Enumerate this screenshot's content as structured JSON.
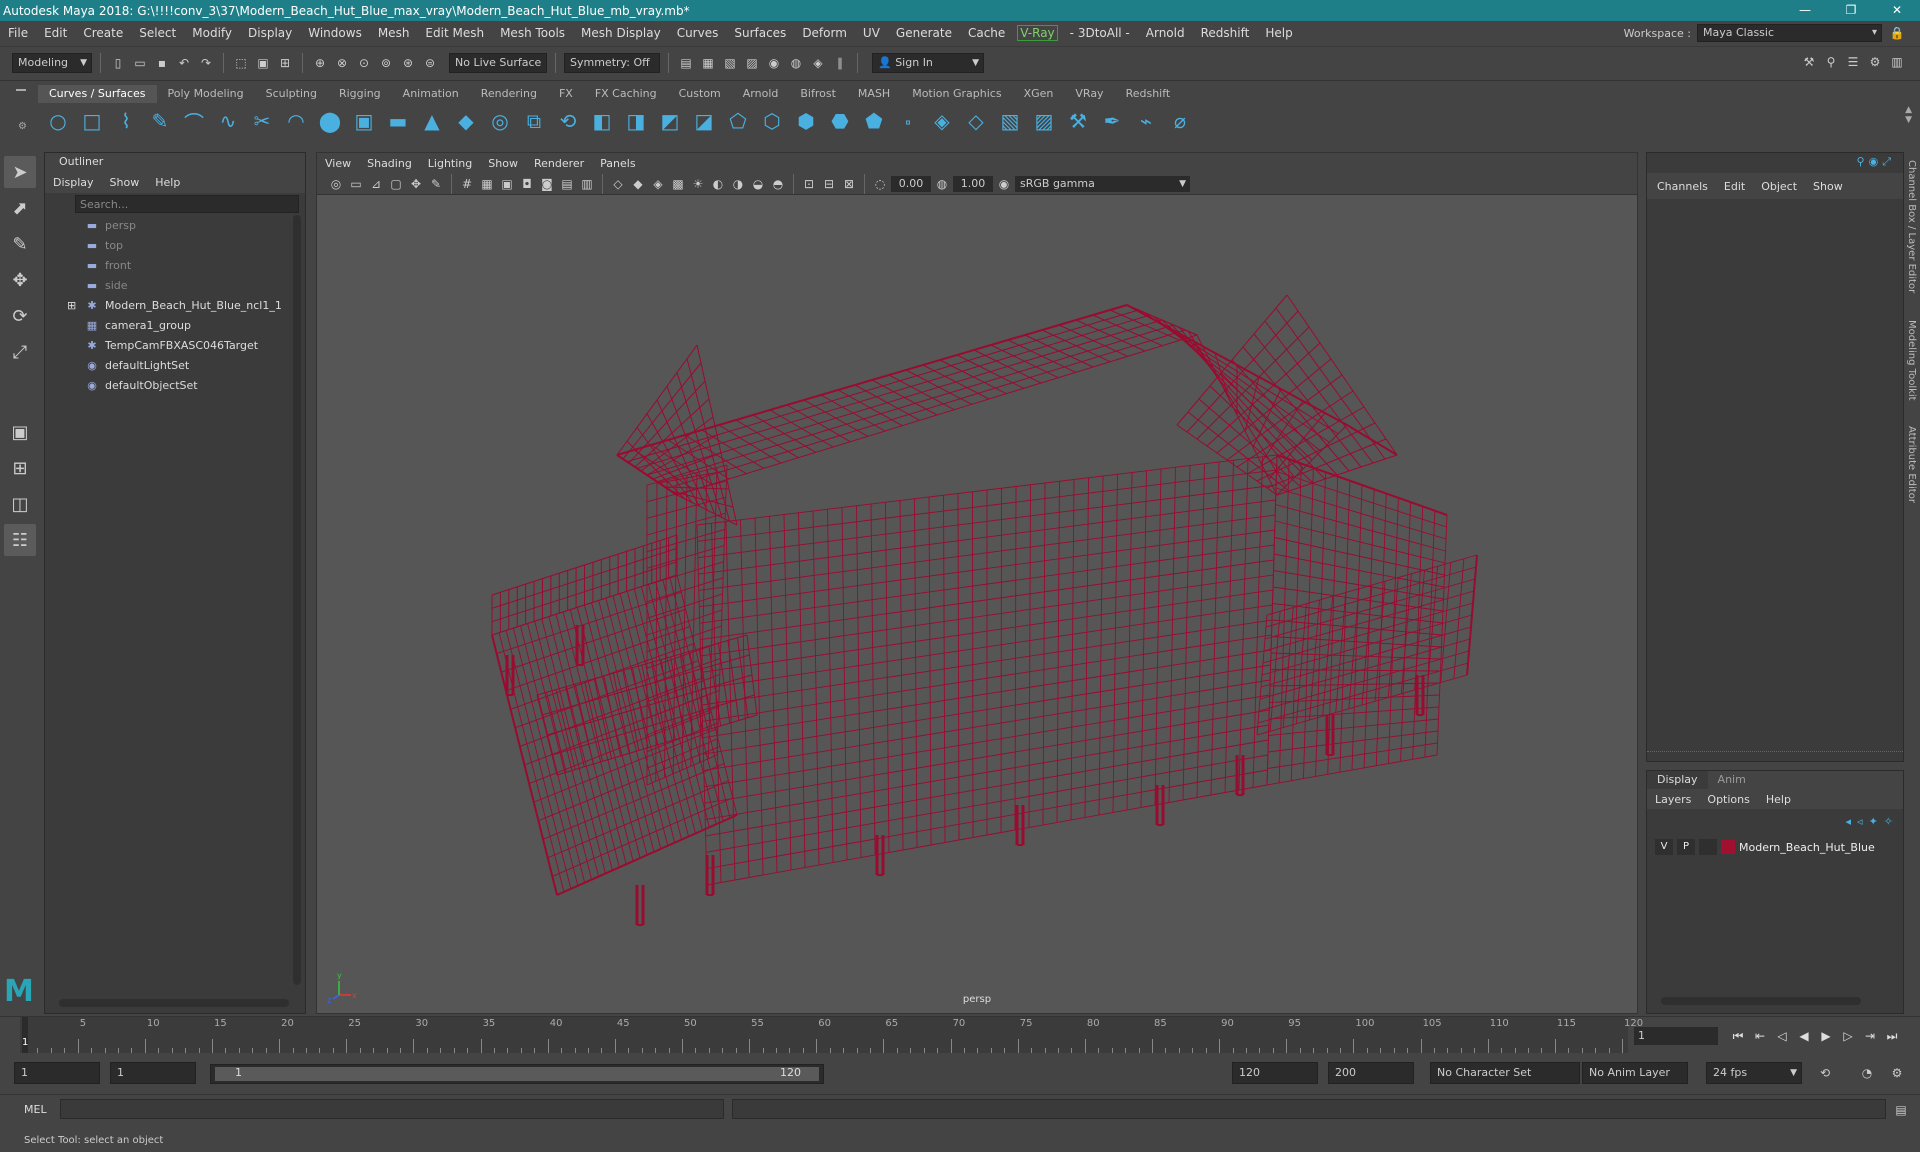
{
  "window": {
    "title": "Autodesk Maya 2018: G:\\!!!!conv_3\\37\\Modern_Beach_Hut_Blue_max_vray\\Modern_Beach_Hut_Blue_mb_vray.mb*",
    "controls": [
      "—",
      "❐",
      "✕"
    ]
  },
  "menus": [
    "File",
    "Edit",
    "Create",
    "Select",
    "Modify",
    "Display",
    "Windows",
    "Mesh",
    "Edit Mesh",
    "Mesh Tools",
    "Mesh Display",
    "Curves",
    "Surfaces",
    "Deform",
    "UV",
    "Generate",
    "Cache"
  ],
  "menus_after": [
    "- 3DtoAll -",
    "Arnold",
    "Redshift",
    "Help"
  ],
  "vray_menu": "V-Ray",
  "workspace": {
    "label": "Workspace :",
    "value": "Maya Classic"
  },
  "status_line": {
    "mode": "Modeling",
    "live_surface": "No Live Surface",
    "symmetry": "Symmetry: Off",
    "sign_in": "Sign In"
  },
  "shelf": {
    "tabs": [
      "Curves / Surfaces",
      "Poly Modeling",
      "Sculpting",
      "Rigging",
      "Animation",
      "Rendering",
      "FX",
      "FX Caching",
      "Custom",
      "Arnold",
      "Bifrost",
      "MASH",
      "Motion Graphics",
      "XGen",
      "VRay",
      "Redshift"
    ],
    "active": "Curves / Surfaces",
    "icons": [
      "nurbs-circle-icon",
      "nurbs-square-icon",
      "cv-curve-icon",
      "ep-curve-icon",
      "pencil-curve-icon",
      "bezier-curve-icon",
      "curve-tool-icon",
      "arc-icon",
      "sphere-icon",
      "cube-icon",
      "cylinder-icon",
      "cone-icon",
      "plane-icon",
      "torus-icon",
      "loft-icon",
      "revolve-icon"
    ]
  },
  "outliner": {
    "title": "Outliner",
    "menu": [
      "Display",
      "Show",
      "Help"
    ],
    "search_placeholder": "Search...",
    "items": [
      {
        "label": "persp",
        "icon": "camera-icon",
        "dim": true
      },
      {
        "label": "top",
        "icon": "camera-icon",
        "dim": true
      },
      {
        "label": "front",
        "icon": "camera-icon",
        "dim": true
      },
      {
        "label": "side",
        "icon": "camera-icon",
        "dim": true
      },
      {
        "label": "Modern_Beach_Hut_Blue_ncl1_1",
        "icon": "transform-icon",
        "dim": false,
        "expand": true
      },
      {
        "label": "camera1_group",
        "icon": "group-icon",
        "dim": false
      },
      {
        "label": "TempCamFBXASC046Target",
        "icon": "transform-icon",
        "dim": false
      },
      {
        "label": "defaultLightSet",
        "icon": "set-icon",
        "dim": false
      },
      {
        "label": "defaultObjectSet",
        "icon": "set-icon",
        "dim": false
      }
    ]
  },
  "viewport": {
    "menu": [
      "View",
      "Shading",
      "Lighting",
      "Show",
      "Renderer",
      "Panels"
    ],
    "exposure": "0.00",
    "gamma": "1.00",
    "colorspace": "sRGB gamma",
    "camera_label": "persp",
    "wire_color": "#9a0b30"
  },
  "channel_box": {
    "menu": [
      "Channels",
      "Edit",
      "Object",
      "Show"
    ]
  },
  "layer_editor": {
    "tabs": [
      "Display",
      "Anim"
    ],
    "active_tab": "Display",
    "menu": [
      "Layers",
      "Options",
      "Help"
    ],
    "layers": [
      {
        "v": "V",
        "p": "P",
        "name": "Modern_Beach_Hut_Blue",
        "color": "#a1102f"
      }
    ]
  },
  "side_tabs": [
    "Channel Box / Layer Editor",
    "Modeling Toolkit",
    "Attribute Editor"
  ],
  "timeline": {
    "labels": [
      "5",
      "10",
      "15",
      "20",
      "25",
      "30",
      "35",
      "40",
      "45",
      "50",
      "55",
      "60",
      "65",
      "70",
      "75",
      "80",
      "85",
      "90",
      "95",
      "100",
      "105",
      "110",
      "115",
      "120"
    ],
    "start_marker": "1",
    "current_frame": "1"
  },
  "range": {
    "start": "1",
    "playback_start": "1",
    "slider_start": "1",
    "slider_end": "120",
    "playback_end": "120",
    "end": "200",
    "character_set": "No Character Set",
    "anim_layer": "No Anim Layer",
    "fps": "24 fps"
  },
  "command_line": {
    "label": "MEL"
  },
  "help_line": "Select Tool: select an object"
}
